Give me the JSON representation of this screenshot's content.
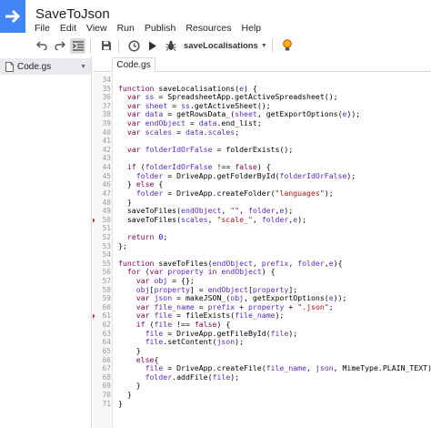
{
  "app": {
    "title": "SaveToJson"
  },
  "menu": {
    "items": [
      "File",
      "Edit",
      "View",
      "Run",
      "Publish",
      "Resources",
      "Help"
    ]
  },
  "toolbar": {
    "function_select": "saveLocalisations",
    "icons": [
      "undo-icon",
      "redo-icon",
      "indent-icon",
      "save-icon",
      "history-icon",
      "run-icon",
      "debug-icon",
      "bulb-icon"
    ]
  },
  "sidebar": {
    "file_label": "Code.gs"
  },
  "tabs": {
    "active": "Code.gs"
  },
  "colors": {
    "keyword": "#7f0055",
    "variable": "#5a2ab3",
    "string": "#a31515",
    "number": "#0000ff",
    "breakpoint": "#d93025",
    "logo": "#4285f4"
  },
  "code": {
    "lines": [
      {
        "n": "34",
        "t": ""
      },
      {
        "n": "35",
        "t": "function saveLocalisations(e) {"
      },
      {
        "n": "36",
        "t": "  var ss = SpreadsheetApp.getActiveSpreadsheet();"
      },
      {
        "n": "37",
        "t": "  var sheet = ss.getActiveSheet();"
      },
      {
        "n": "38",
        "t": "  var data = getRowsData_(sheet, getExportOptions(e));"
      },
      {
        "n": "39",
        "t": "  var endObject = data.end_list;"
      },
      {
        "n": "40",
        "t": "  var scales = data.scales;"
      },
      {
        "n": "41",
        "t": ""
      },
      {
        "n": "42",
        "t": "  var folderIdOrFalse = folderExists();"
      },
      {
        "n": "43",
        "t": ""
      },
      {
        "n": "44",
        "t": "  if (folderIdOrFalse !== false) {"
      },
      {
        "n": "45",
        "t": "    folder = DriveApp.getFolderById(folderIdOrFalse);"
      },
      {
        "n": "46",
        "t": "  } else {"
      },
      {
        "n": "47",
        "t": "    folder = DriveApp.createFolder(\"languages\");"
      },
      {
        "n": "48",
        "t": "  }"
      },
      {
        "n": "49",
        "t": "  saveToFiles(endObject, \"\", folder,e);"
      },
      {
        "n": "50",
        "t": "  saveToFiles(scales, \"scale_\", folder,e);",
        "bp": true
      },
      {
        "n": "51",
        "t": ""
      },
      {
        "n": "52",
        "t": "  return 0;"
      },
      {
        "n": "53",
        "t": "};"
      },
      {
        "n": "54",
        "t": ""
      },
      {
        "n": "55",
        "t": "function saveToFiles(endObject, prefix, folder,e){"
      },
      {
        "n": "56",
        "t": "  for (var property in endObject) {"
      },
      {
        "n": "57",
        "t": "    var obj = {};"
      },
      {
        "n": "58",
        "t": "    obj[property] = endObject[property];"
      },
      {
        "n": "59",
        "t": "    var json = makeJSON_(obj, getExportOptions(e));"
      },
      {
        "n": "60",
        "t": "    var file_name = prefix + property + \".json\";"
      },
      {
        "n": "61",
        "t": "    var file = fileExists(file_name);",
        "bp": true
      },
      {
        "n": "62",
        "t": "    if (file !== false) {"
      },
      {
        "n": "63",
        "t": "      file = DriveApp.getFileById(file);"
      },
      {
        "n": "64",
        "t": "      file.setContent(json);"
      },
      {
        "n": "65",
        "t": "    }"
      },
      {
        "n": "66",
        "t": "    else{"
      },
      {
        "n": "67",
        "t": "      file = DriveApp.createFile(file_name, json, MimeType.PLAIN_TEXT);"
      },
      {
        "n": "68",
        "t": "      folder.addFile(file);"
      },
      {
        "n": "69",
        "t": "    }"
      },
      {
        "n": "70",
        "t": "  }"
      },
      {
        "n": "71",
        "t": "}"
      }
    ]
  }
}
